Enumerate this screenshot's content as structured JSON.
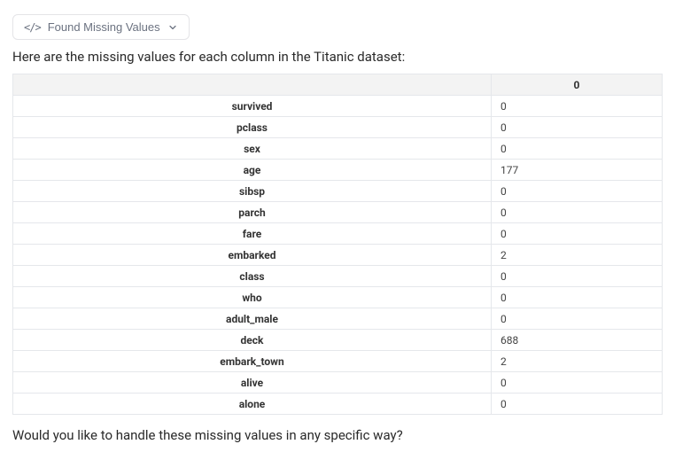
{
  "badge": {
    "label": "Found Missing Values"
  },
  "intro": "Here are the missing values for each column in the Titanic dataset:",
  "table": {
    "header_blank": "",
    "header_value": "0",
    "rows": [
      {
        "label": "survived",
        "value": "0"
      },
      {
        "label": "pclass",
        "value": "0"
      },
      {
        "label": "sex",
        "value": "0"
      },
      {
        "label": "age",
        "value": "177"
      },
      {
        "label": "sibsp",
        "value": "0"
      },
      {
        "label": "parch",
        "value": "0"
      },
      {
        "label": "fare",
        "value": "0"
      },
      {
        "label": "embarked",
        "value": "2"
      },
      {
        "label": "class",
        "value": "0"
      },
      {
        "label": "who",
        "value": "0"
      },
      {
        "label": "adult_male",
        "value": "0"
      },
      {
        "label": "deck",
        "value": "688"
      },
      {
        "label": "embark_town",
        "value": "2"
      },
      {
        "label": "alive",
        "value": "0"
      },
      {
        "label": "alone",
        "value": "0"
      }
    ]
  },
  "outro": "Would you like to handle these missing values in any specific way?"
}
